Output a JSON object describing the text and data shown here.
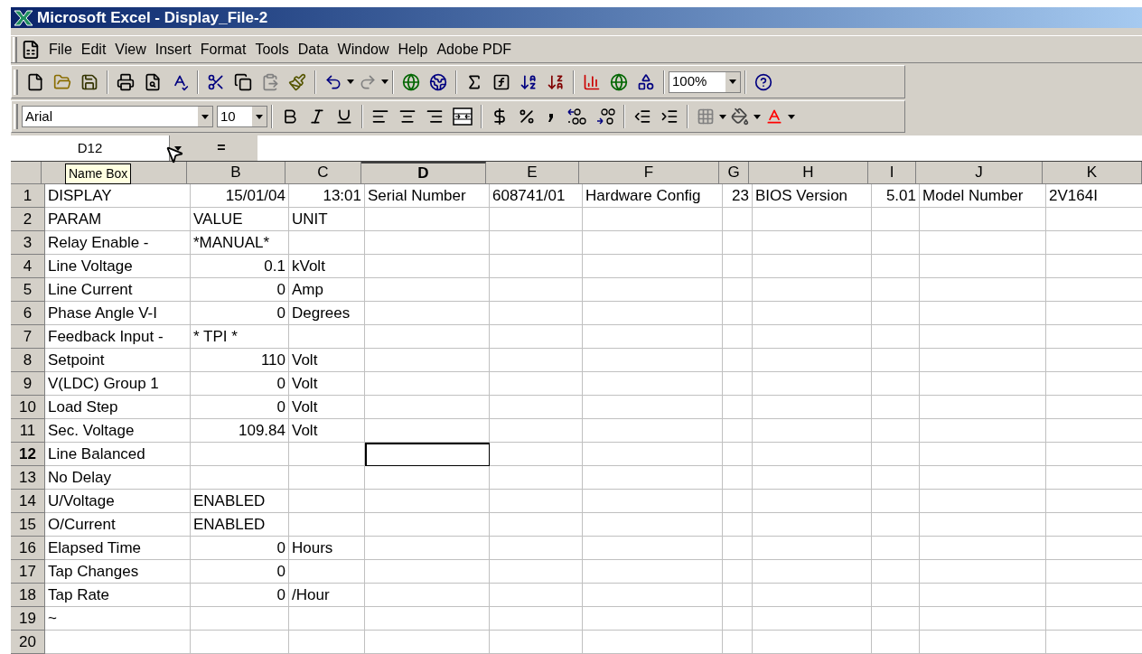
{
  "window": {
    "title": "Microsoft Excel - Display_File-2"
  },
  "menu": [
    "File",
    "Edit",
    "View",
    "Insert",
    "Format",
    "Tools",
    "Data",
    "Window",
    "Help",
    "Adobe PDF"
  ],
  "standard_toolbar": {
    "zoom": "100%"
  },
  "formatting_toolbar": {
    "font": "Arial",
    "size": "10"
  },
  "formula_bar": {
    "name_box": "D12",
    "equals": "=",
    "tooltip": "Name Box"
  },
  "columns": [
    {
      "selected": false
    },
    {
      "label": "B",
      "selected": false
    },
    {
      "label": "C",
      "selected": false
    },
    {
      "label": "D",
      "selected": true
    },
    {
      "label": "E",
      "selected": false
    },
    {
      "label": "F",
      "selected": false
    },
    {
      "label": "G",
      "selected": false
    },
    {
      "label": "H",
      "selected": false
    },
    {
      "label": "I",
      "selected": false
    },
    {
      "label": "J",
      "selected": false
    },
    {
      "label": "K",
      "selected": false
    }
  ],
  "rows": [
    {
      "number": "1",
      "selected": false,
      "cells": [
        {
          "kind": "text",
          "text": "DISPLAY"
        },
        {
          "kind": "number",
          "text": "15/01/04"
        },
        {
          "kind": "number",
          "text": "13:01"
        },
        {
          "kind": "text",
          "text": "Serial Number"
        },
        {
          "kind": "text",
          "text": "608741/01"
        },
        {
          "kind": "text",
          "text": "Hardware Config"
        },
        {
          "kind": "number",
          "text": "23"
        },
        {
          "kind": "text",
          "text": "BIOS Version"
        },
        {
          "kind": "number",
          "text": "5.01"
        },
        {
          "kind": "text",
          "text": "Model Number"
        },
        {
          "kind": "text",
          "text": "2V164I"
        }
      ]
    },
    {
      "number": "2",
      "selected": false,
      "cells": [
        {
          "kind": "text",
          "text": "PARAM"
        },
        {
          "kind": "text",
          "text": "VALUE"
        },
        {
          "kind": "text",
          "text": "UNIT"
        }
      ]
    },
    {
      "number": "3",
      "selected": false,
      "cells": [
        {
          "kind": "text",
          "text": "Relay Enable -"
        },
        {
          "kind": "text",
          "text": "*MANUAL*"
        }
      ]
    },
    {
      "number": "4",
      "selected": false,
      "cells": [
        {
          "kind": "text",
          "text": "Line Voltage"
        },
        {
          "kind": "number",
          "text": "0.1"
        },
        {
          "kind": "text",
          "text": "kVolt"
        }
      ]
    },
    {
      "number": "5",
      "selected": false,
      "cells": [
        {
          "kind": "text",
          "text": "Line Current"
        },
        {
          "kind": "number",
          "text": "0"
        },
        {
          "kind": "text",
          "text": "Amp"
        }
      ]
    },
    {
      "number": "6",
      "selected": false,
      "cells": [
        {
          "kind": "text",
          "text": "Phase Angle V-I"
        },
        {
          "kind": "number",
          "text": "0"
        },
        {
          "kind": "text",
          "text": "Degrees"
        }
      ]
    },
    {
      "number": "7",
      "selected": false,
      "cells": [
        {
          "kind": "text",
          "text": "Feedback Input -"
        },
        {
          "kind": "text",
          "text": "* TPI *"
        }
      ]
    },
    {
      "number": "8",
      "selected": false,
      "cells": [
        {
          "kind": "text",
          "text": "Setpoint"
        },
        {
          "kind": "number",
          "text": "110"
        },
        {
          "kind": "text",
          "text": "Volt"
        }
      ]
    },
    {
      "number": "9",
      "selected": false,
      "cells": [
        {
          "kind": "text",
          "text": "V(LDC) Group 1"
        },
        {
          "kind": "number",
          "text": "0"
        },
        {
          "kind": "text",
          "text": "Volt"
        }
      ]
    },
    {
      "number": "10",
      "selected": false,
      "cells": [
        {
          "kind": "text",
          "text": "Load Step"
        },
        {
          "kind": "number",
          "text": "0"
        },
        {
          "kind": "text",
          "text": "Volt"
        }
      ]
    },
    {
      "number": "11",
      "selected": false,
      "cells": [
        {
          "kind": "text",
          "text": "Sec. Voltage"
        },
        {
          "kind": "number",
          "text": "109.84"
        },
        {
          "kind": "text",
          "text": "Volt"
        }
      ]
    },
    {
      "number": "12",
      "selected": true,
      "cells": [
        {
          "kind": "text",
          "text": "Line Balanced"
        }
      ]
    },
    {
      "number": "13",
      "selected": false,
      "cells": [
        {
          "kind": "text",
          "text": "No Delay"
        }
      ]
    },
    {
      "number": "14",
      "selected": false,
      "cells": [
        {
          "kind": "text",
          "text": "U/Voltage"
        },
        {
          "kind": "text",
          "text": "ENABLED"
        }
      ]
    },
    {
      "number": "15",
      "selected": false,
      "cells": [
        {
          "kind": "text",
          "text": "O/Current"
        },
        {
          "kind": "text",
          "text": "ENABLED"
        }
      ]
    },
    {
      "number": "16",
      "selected": false,
      "cells": [
        {
          "kind": "text",
          "text": "Elapsed Time"
        },
        {
          "kind": "number",
          "text": "0"
        },
        {
          "kind": "text",
          "text": "Hours"
        }
      ]
    },
    {
      "number": "17",
      "selected": false,
      "cells": [
        {
          "kind": "text",
          "text": "Tap Changes"
        },
        {
          "kind": "number",
          "text": "0"
        }
      ]
    },
    {
      "number": "18",
      "selected": false,
      "cells": [
        {
          "kind": "text",
          "text": "Tap Rate"
        },
        {
          "kind": "number",
          "text": "0"
        },
        {
          "kind": "text",
          "text": "/Hour"
        }
      ]
    },
    {
      "number": "19",
      "selected": false,
      "cells": [
        {
          "kind": "text",
          "text": "~"
        }
      ]
    },
    {
      "number": "20",
      "selected": false,
      "cells": []
    }
  ]
}
